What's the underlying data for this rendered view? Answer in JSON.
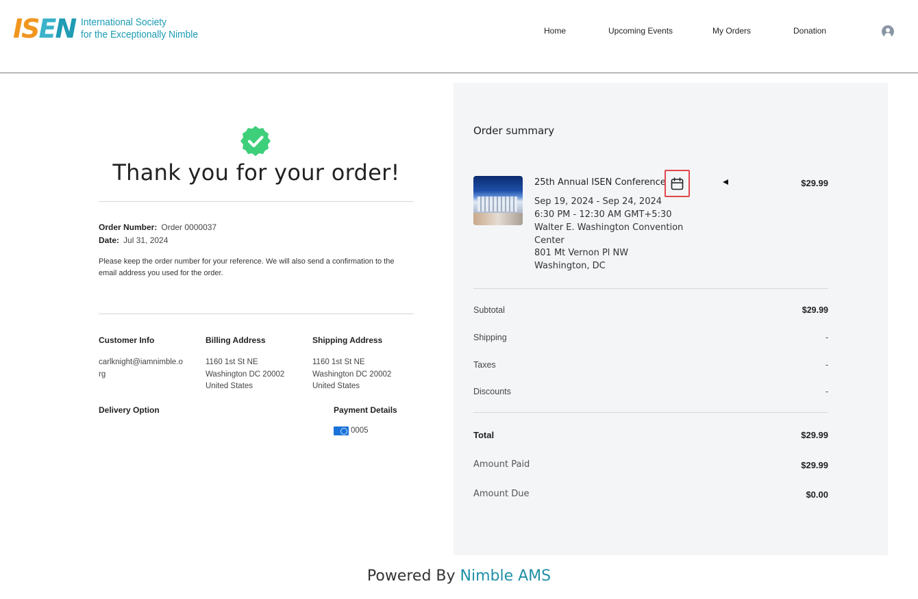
{
  "logo": {
    "mark": [
      "I",
      "S",
      "E",
      "N"
    ],
    "line1": "International Society",
    "line2": "for the Exceptionally Nimble"
  },
  "nav": {
    "items": [
      "Home",
      "Upcoming Events",
      "My Orders",
      "Donation"
    ],
    "user_icon": "user-avatar-icon"
  },
  "confirmation": {
    "icon": "check-badge-icon",
    "title": "Thank you for your order!",
    "order_number_label": "Order Number:",
    "order_number_value": "Order 0000037",
    "date_label": "Date:",
    "date_value": "Jul 31, 2024",
    "note": "Please keep the order number for your reference. We will also send a confirmation to the email address you used for the order."
  },
  "details": {
    "customer_info": {
      "heading": "Customer Info",
      "lines": [
        "carlknight@iamnimble.o",
        "rg"
      ]
    },
    "billing": {
      "heading": "Billing Address",
      "lines": [
        "1160 1st St NE",
        "Washington DC 20002",
        "United States"
      ]
    },
    "shipping": {
      "heading": "Shipping Address",
      "lines": [
        "1160 1st St NE",
        "Washington DC 20002",
        "United States"
      ]
    },
    "delivery": {
      "heading": "Delivery Option"
    },
    "payment": {
      "heading": "Payment Details",
      "card_last4": "0005",
      "card_icon": "credit-card-icon"
    }
  },
  "summary": {
    "title": "Order summary",
    "item": {
      "name": "25th Annual ISEN Conference",
      "price": "$29.99",
      "dates": "Sep 19, 2024 - Sep 24, 2024",
      "times": "6:30 PM - 12:30 AM GMT+5:30",
      "venue_line1": "Walter E. Washington Convention",
      "venue_line2": "Center",
      "street": "801 Mt Vernon Pl NW",
      "city": "Washington, DC",
      "calendar_icon": "calendar-icon",
      "expand_icon": "caret-left-icon"
    },
    "rows": [
      {
        "label": "Subtotal",
        "value": "$29.99"
      },
      {
        "label": "Shipping",
        "value": "-"
      },
      {
        "label": "Taxes",
        "value": "-"
      },
      {
        "label": "Discounts",
        "value": "-"
      }
    ],
    "total": {
      "label": "Total",
      "value": "$29.99"
    },
    "amount_paid": {
      "label": "Amount Paid",
      "value": "$29.99"
    },
    "amount_due": {
      "label": "Amount Due",
      "value": "$0.00"
    }
  },
  "footer": {
    "prefix": "Powered By",
    "brand": "Nimble AMS"
  },
  "colors": {
    "accent_teal": "#1f9cb4",
    "logo_orange": "#f0961e",
    "success_green": "#3ecf7a",
    "highlight_red": "#e0474c",
    "summary_bg": "#f4f5f7"
  }
}
